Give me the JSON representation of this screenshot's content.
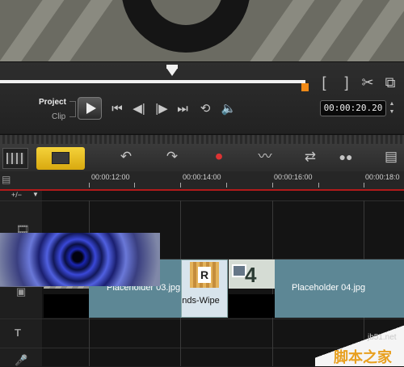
{
  "player": {
    "project_label": "Project",
    "clip_label": "Clip",
    "timecode": "00:00:20.20",
    "controls": {
      "home": "⏮",
      "prev_frame": "◀|",
      "next_frame": "|▶",
      "end": "⏭",
      "repeat": "⟲",
      "volume": "🔈",
      "mark_in": "[",
      "mark_out": "]",
      "split": "✂",
      "enlarge": "⧉",
      "tc_up": "▲",
      "tc_down": "▼"
    }
  },
  "toolbar": {
    "undo": "↶",
    "redo": "↷",
    "record": "⏺",
    "audio_mixer": "〰",
    "auto_music": "⇄",
    "motion_track": "●●",
    "subtitle": "▤"
  },
  "ruler": {
    "labels": [
      "00:00:12:00",
      "00:00:14:00",
      "00:00:16:00",
      "00:00:18:0"
    ]
  },
  "track_header": {
    "add_remove": "+/−"
  },
  "clips": {
    "clip3_name": "Placeholder 03.jpg",
    "transition_name": "Blinds-Wipe",
    "clip4_name": "Placeholder 04.jpg",
    "clip4_number": "4"
  },
  "watermark": {
    "site": "jb51.net",
    "text": "脚本之家"
  }
}
